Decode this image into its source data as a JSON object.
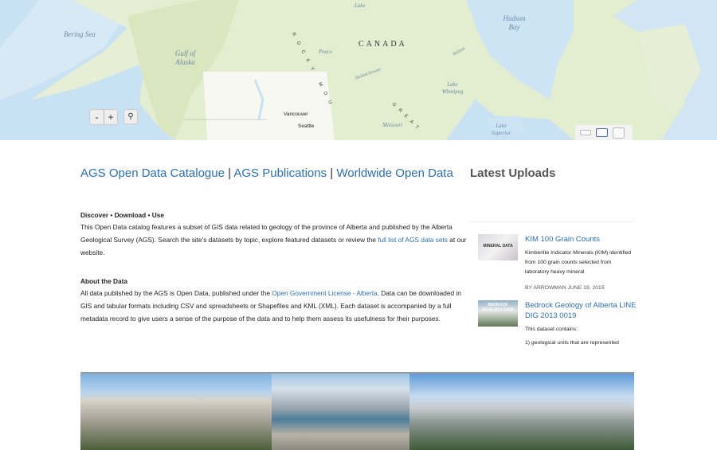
{
  "map": {
    "labels": {
      "bering": "Bering Sea",
      "gulf": "Gulf of Alaska",
      "hudson": "Hudson Bay",
      "winnipeg": "Lake Winnipeg",
      "superior": "Lake Superior",
      "peace": "Peace",
      "sask": "Saskatchewan",
      "nelson": "Nelson",
      "missouri": "Missouri",
      "lake_top": "Lake"
    },
    "country": "CANADA",
    "cities": {
      "vancouver": "Vancouver",
      "seattle": "Seattle"
    },
    "rocky": "ROCKY MOU",
    "great": "GREAT",
    "zoom_out": "-",
    "zoom_in": "+",
    "search_icon": "magnifier-icon",
    "colors": {
      "ocean": "#c9e2f3",
      "land": "#e3edcf",
      "plains": "#f6f8f1"
    }
  },
  "nav": {
    "catalogue": "AGS Open Data Catalogue",
    "sep": "|",
    "publications": "AGS Publications",
    "worldwide": "Worldwide Open Data"
  },
  "latest_title": "Latest Uploads",
  "discover": {
    "heading": "Discover • Download • Use",
    "text1": "This Open Data catalog features a subset of GIS data related to geology of the province of Alberta and published by the Alberta Geological Survey (AGS). Search the site's datasets by topic, explore featured datasets or review the ",
    "link": "full list of AGS data sets",
    "text2": " at our website."
  },
  "about": {
    "heading": "About the Data",
    "text1": "All data published by the AGS is Open Data, published under the ",
    "link": "Open Government License - Alberta",
    "text2": ". Data can be downloaded in GIS and tabular formats including CSV and spreadsheets or Shapefiles and KML (XML). Each dataset is accompanied by a full metadata record to give users a sense of the purpose of the data and to help them assess its usefulness for their purposes."
  },
  "uploads": [
    {
      "title": "KIM 100 Grain Counts",
      "desc": "Kimberlite Indicator Minerals (KIM) identified from 100 grain counts selected from laboratory heavy mineral",
      "meta": "BY ARROWMAN JUNE 19, 2015",
      "thumb_text": "MINERAL DATA"
    },
    {
      "title": "Bedrock Geology of Alberta LINE DIG 2013 0019",
      "desc": "This dataset contains:",
      "desc2": "1) geological units that are represented",
      "thumb_text": "BEDROCK GEOLOGY DATA"
    }
  ],
  "link_color": "#2c6fb5"
}
